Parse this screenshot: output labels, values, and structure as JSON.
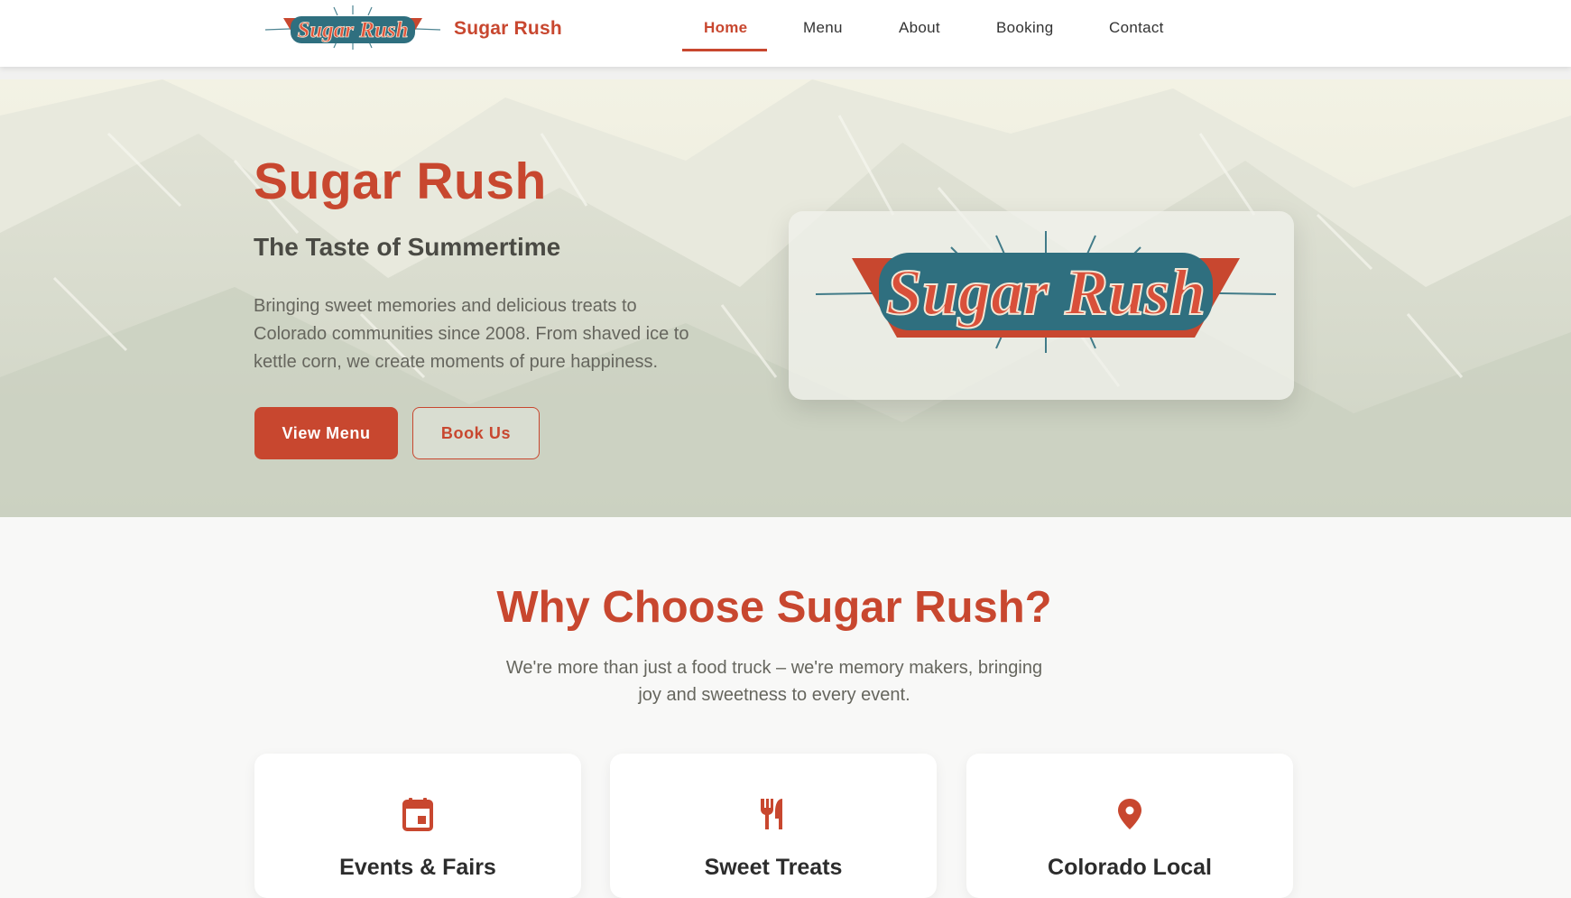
{
  "header": {
    "brand_name": "Sugar Rush",
    "nav": [
      {
        "label": "Home",
        "active": true
      },
      {
        "label": "Menu",
        "active": false
      },
      {
        "label": "About",
        "active": false
      },
      {
        "label": "Booking",
        "active": false
      },
      {
        "label": "Contact",
        "active": false
      }
    ]
  },
  "hero": {
    "title": "Sugar Rush",
    "subtitle": "The Taste of Summertime",
    "description": "Bringing sweet memories and delicious treats to Colorado communities since 2008. From shaved ice to kettle corn, we create moments of pure happiness.",
    "primary_button": "View Menu",
    "secondary_button": "Book Us",
    "logo_text": "Sugar Rush"
  },
  "why": {
    "title": "Why Choose Sugar Rush?",
    "description": "We're more than just a food truck – we're memory makers, bringing joy and sweetness to every event.",
    "cards": [
      {
        "icon": "calendar-icon",
        "title": "Events & Fairs"
      },
      {
        "icon": "utensils-icon",
        "title": "Sweet Treats"
      },
      {
        "icon": "map-pin-icon",
        "title": "Colorado Local"
      }
    ]
  },
  "colors": {
    "accent": "#c8472f",
    "logo_teal": "#2f6f7f",
    "background": "#f8f8f7"
  }
}
